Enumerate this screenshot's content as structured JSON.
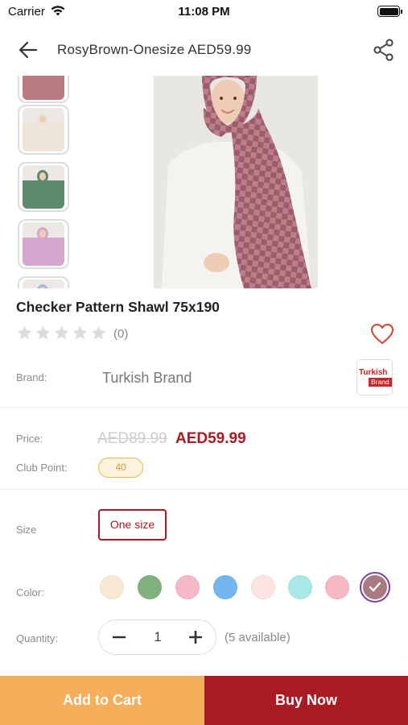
{
  "status_bar": {
    "carrier": "Carrier",
    "time": "11:08 PM"
  },
  "header": {
    "title": "RosyBrown-Onesize AED59.99",
    "back_icon": "arrow-left-icon",
    "share_icon": "share-icon"
  },
  "gallery": {
    "thumbnails": [
      {
        "name": "thumb-rosybrown-top",
        "color": "#b97a82"
      },
      {
        "name": "thumb-cream",
        "color": "#ede6d8"
      },
      {
        "name": "thumb-green",
        "color": "#5c8a6a"
      },
      {
        "name": "thumb-pink",
        "color": "#d7a6cf"
      },
      {
        "name": "thumb-blue",
        "color": "#9db8dc"
      }
    ],
    "main_image_color": "#a4616f"
  },
  "product": {
    "title": "Checker Pattern Shawl 75x190",
    "rating": 0,
    "max_rating": 5,
    "review_count": "(0)"
  },
  "brand": {
    "label": "Brand:",
    "name": "Turkish Brand",
    "logo_line1": "Turkish",
    "logo_line2": "Brand"
  },
  "price": {
    "label": "Price:",
    "old": "AED89.99",
    "new": "AED59.99"
  },
  "club_point": {
    "label": "Club Point:",
    "value": "40"
  },
  "size": {
    "label": "Size",
    "selected": "One size"
  },
  "color": {
    "label": "Color:",
    "swatches": [
      "#f8e8d4",
      "#7fb27e",
      "#f6b8c7",
      "#74b6f1",
      "#fde3e3",
      "#a8e8e6",
      "#f8b7c5",
      "#a97b80"
    ],
    "selected_index": 7
  },
  "quantity": {
    "label": "Quantity:",
    "value": "1",
    "available": "(5 available)"
  },
  "actions": {
    "add_to_cart": "Add to Cart",
    "buy_now": "Buy Now"
  },
  "colors": {
    "accent": "#a91b23",
    "cart": "#f5ae5a",
    "club": "#f0b64b"
  }
}
